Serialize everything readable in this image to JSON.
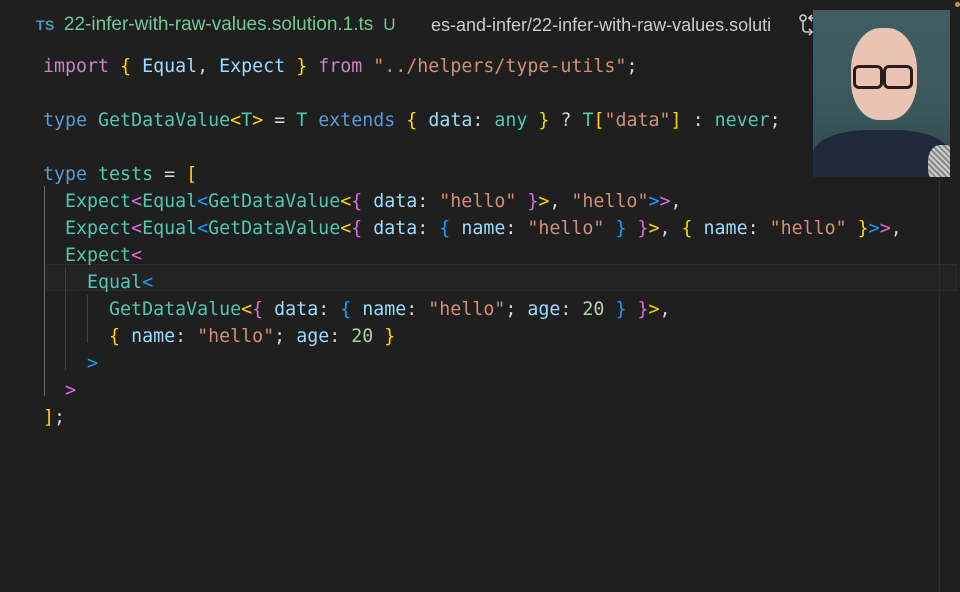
{
  "tab": {
    "language_icon": "TS",
    "filename": "22-infer-with-raw-values.solution.1.ts",
    "git_status": "U"
  },
  "breadcrumb": "es-and-infer/22-infer-with-raw-values.soluti",
  "toolbar": {
    "compare_icon": "git-compare-icon"
  },
  "webcam": {
    "description": "presenter webcam overlay"
  },
  "code": {
    "lines": [
      [
        [
          "k-kw",
          "import"
        ],
        [
          "k-op",
          " "
        ],
        [
          "b1",
          "{"
        ],
        [
          "k-op",
          " "
        ],
        [
          "k-id",
          "Equal"
        ],
        [
          "k-op",
          ", "
        ],
        [
          "k-id",
          "Expect"
        ],
        [
          "k-op",
          " "
        ],
        [
          "b1",
          "}"
        ],
        [
          "k-op",
          " "
        ],
        [
          "k-kw",
          "from"
        ],
        [
          "k-op",
          " "
        ],
        [
          "k-str",
          "\"../helpers/type-utils\""
        ],
        [
          "k-op",
          ";"
        ]
      ],
      [],
      [
        [
          "k-type",
          "type"
        ],
        [
          "k-op",
          " "
        ],
        [
          "k-cls",
          "GetDataValue"
        ],
        [
          "b1",
          "<"
        ],
        [
          "k-cls",
          "T"
        ],
        [
          "b1",
          ">"
        ],
        [
          "k-op",
          " = "
        ],
        [
          "k-cls",
          "T"
        ],
        [
          "k-op",
          " "
        ],
        [
          "k-type",
          "extends"
        ],
        [
          "k-op",
          " "
        ],
        [
          "b1",
          "{"
        ],
        [
          "k-op",
          " "
        ],
        [
          "k-id",
          "data"
        ],
        [
          "k-op",
          ": "
        ],
        [
          "k-cls",
          "any"
        ],
        [
          "k-op",
          " "
        ],
        [
          "b1",
          "}"
        ],
        [
          "k-op",
          " ? "
        ],
        [
          "k-cls",
          "T"
        ],
        [
          "b1",
          "["
        ],
        [
          "k-str",
          "\"data\""
        ],
        [
          "b1",
          "]"
        ],
        [
          "k-op",
          " : "
        ],
        [
          "k-cls",
          "never"
        ],
        [
          "k-op",
          ";"
        ]
      ],
      [],
      [
        [
          "k-type",
          "type"
        ],
        [
          "k-op",
          " "
        ],
        [
          "k-cls",
          "tests"
        ],
        [
          "k-op",
          " = "
        ],
        [
          "b1",
          "["
        ]
      ],
      [
        [
          "k-op",
          "  "
        ],
        [
          "k-cls",
          "Expect"
        ],
        [
          "b2",
          "<"
        ],
        [
          "k-cls",
          "Equal"
        ],
        [
          "b3",
          "<"
        ],
        [
          "k-cls",
          "GetDataValue"
        ],
        [
          "b1",
          "<"
        ],
        [
          "b2",
          "{"
        ],
        [
          "k-op",
          " "
        ],
        [
          "k-id",
          "data"
        ],
        [
          "k-op",
          ": "
        ],
        [
          "k-str",
          "\"hello\""
        ],
        [
          "k-op",
          " "
        ],
        [
          "b2",
          "}"
        ],
        [
          "b1",
          ">"
        ],
        [
          "k-op",
          ", "
        ],
        [
          "k-str",
          "\"hello\""
        ],
        [
          "b3",
          ">"
        ],
        [
          "b2",
          ">"
        ],
        [
          "k-op",
          ","
        ]
      ],
      [
        [
          "k-op",
          "  "
        ],
        [
          "k-cls",
          "Expect"
        ],
        [
          "b2",
          "<"
        ],
        [
          "k-cls",
          "Equal"
        ],
        [
          "b3",
          "<"
        ],
        [
          "k-cls",
          "GetDataValue"
        ],
        [
          "b1",
          "<"
        ],
        [
          "b2",
          "{"
        ],
        [
          "k-op",
          " "
        ],
        [
          "k-id",
          "data"
        ],
        [
          "k-op",
          ": "
        ],
        [
          "b3",
          "{"
        ],
        [
          "k-op",
          " "
        ],
        [
          "k-id",
          "name"
        ],
        [
          "k-op",
          ": "
        ],
        [
          "k-str",
          "\"hello\""
        ],
        [
          "k-op",
          " "
        ],
        [
          "b3",
          "}"
        ],
        [
          "k-op",
          " "
        ],
        [
          "b2",
          "}"
        ],
        [
          "b1",
          ">"
        ],
        [
          "k-op",
          ", "
        ],
        [
          "b1",
          "{"
        ],
        [
          "k-op",
          " "
        ],
        [
          "k-id",
          "name"
        ],
        [
          "k-op",
          ": "
        ],
        [
          "k-str",
          "\"hello\""
        ],
        [
          "k-op",
          " "
        ],
        [
          "b1",
          "}"
        ],
        [
          "b3",
          ">"
        ],
        [
          "b2",
          ">"
        ],
        [
          "k-op",
          ","
        ]
      ],
      [
        [
          "k-op",
          "  "
        ],
        [
          "k-cls",
          "Expect"
        ],
        [
          "b2",
          "<"
        ]
      ],
      [
        [
          "k-op",
          "    "
        ],
        [
          "k-cls",
          "Equal"
        ],
        [
          "b3",
          "<"
        ]
      ],
      [
        [
          "k-op",
          "      "
        ],
        [
          "k-cls",
          "GetDataValue"
        ],
        [
          "b1",
          "<"
        ],
        [
          "b2",
          "{"
        ],
        [
          "k-op",
          " "
        ],
        [
          "k-id",
          "data"
        ],
        [
          "k-op",
          ": "
        ],
        [
          "b3",
          "{"
        ],
        [
          "k-op",
          " "
        ],
        [
          "k-id",
          "name"
        ],
        [
          "k-op",
          ": "
        ],
        [
          "k-str",
          "\"hello\""
        ],
        [
          "k-op",
          "; "
        ],
        [
          "k-id",
          "age"
        ],
        [
          "k-op",
          ": "
        ],
        [
          "k-num",
          "20"
        ],
        [
          "k-op",
          " "
        ],
        [
          "b3",
          "}"
        ],
        [
          "k-op",
          " "
        ],
        [
          "b2",
          "}"
        ],
        [
          "b1",
          ">"
        ],
        [
          "k-op",
          ","
        ]
      ],
      [
        [
          "k-op",
          "      "
        ],
        [
          "b1",
          "{"
        ],
        [
          "k-op",
          " "
        ],
        [
          "k-id",
          "name"
        ],
        [
          "k-op",
          ": "
        ],
        [
          "k-str",
          "\"hello\""
        ],
        [
          "k-op",
          "; "
        ],
        [
          "k-id",
          "age"
        ],
        [
          "k-op",
          ": "
        ],
        [
          "k-num",
          "20"
        ],
        [
          "k-op",
          " "
        ],
        [
          "b1",
          "}"
        ]
      ],
      [
        [
          "k-op",
          "    "
        ],
        [
          "b3",
          ">"
        ]
      ],
      [
        [
          "k-op",
          "  "
        ],
        [
          "b2",
          ">"
        ]
      ],
      [
        [
          "b1",
          "]"
        ],
        [
          "k-op",
          ";"
        ]
      ]
    ],
    "current_line_index": 6
  }
}
